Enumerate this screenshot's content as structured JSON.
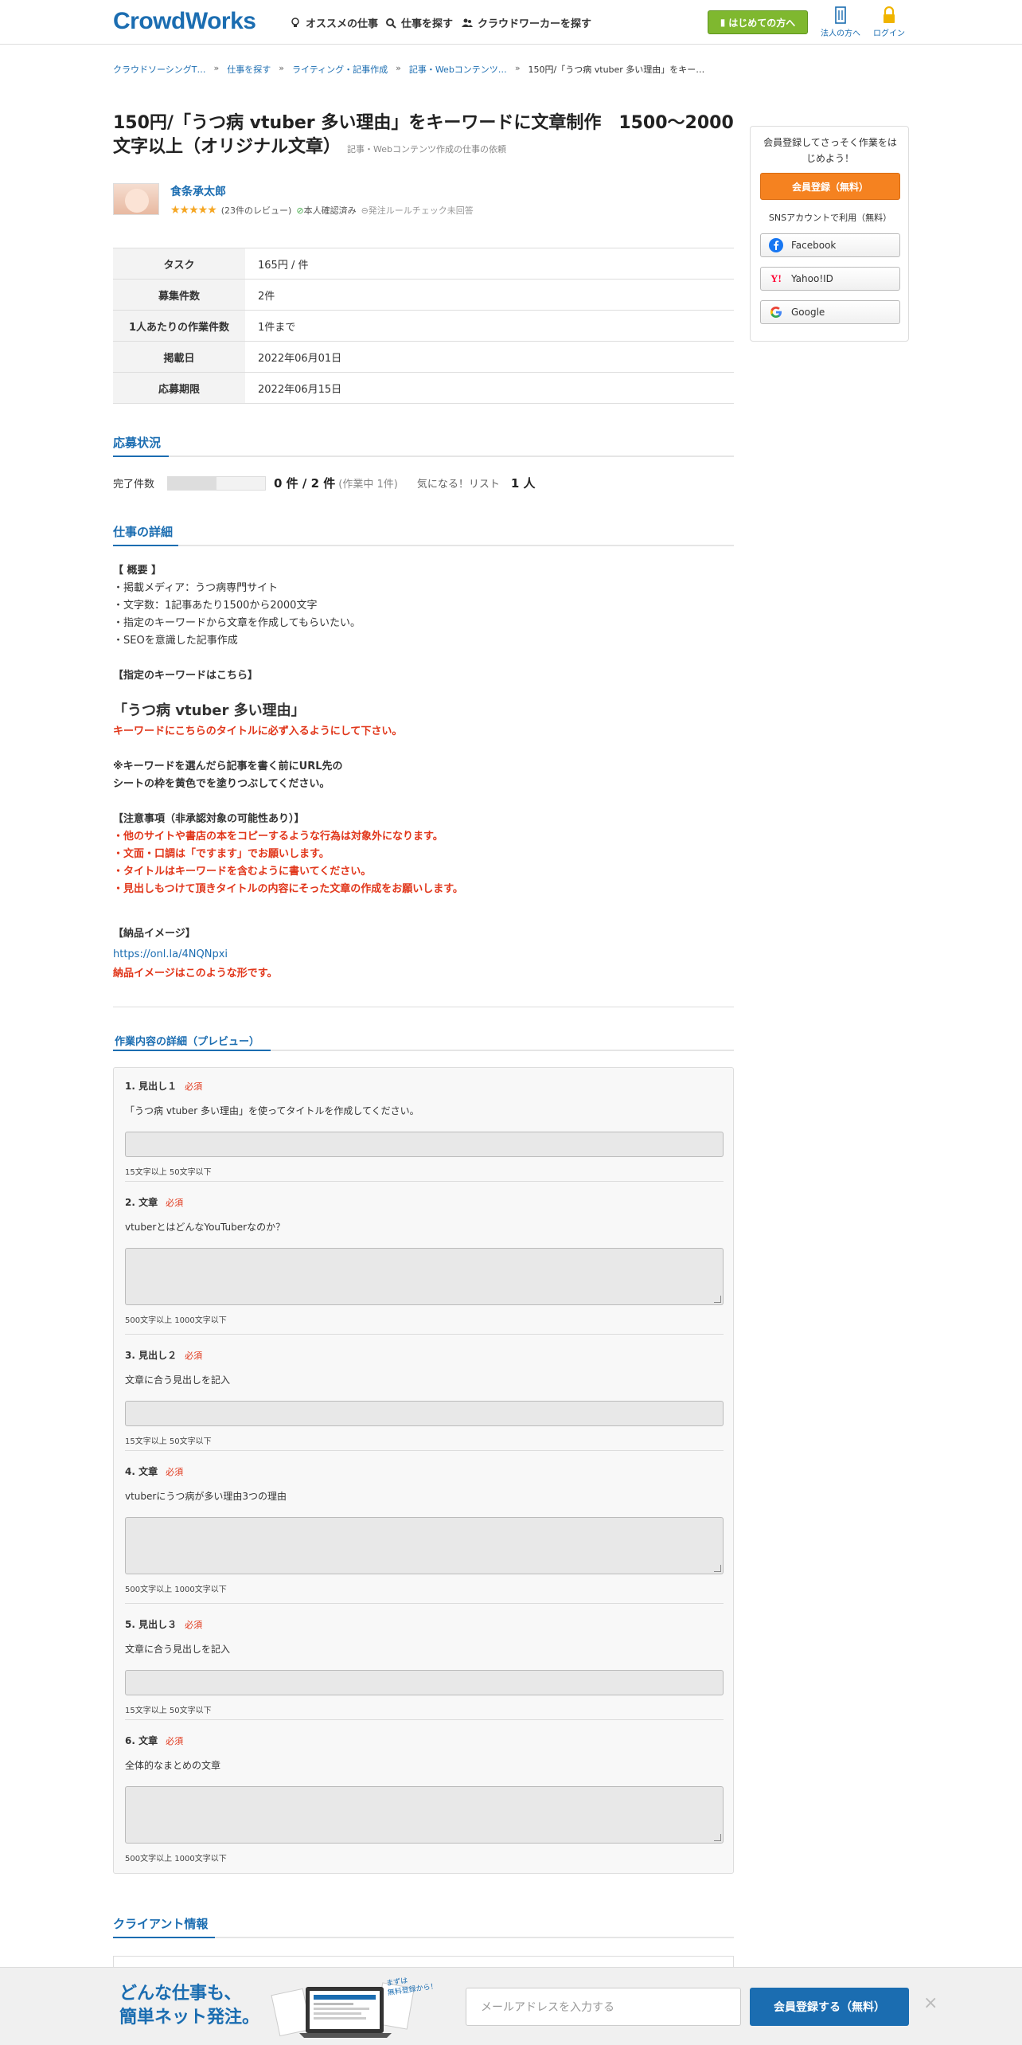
{
  "header": {
    "logo": "CrowdWorks",
    "nav": [
      {
        "label": "オススメの仕事",
        "icon": "bulb-icon"
      },
      {
        "label": "仕事を探す",
        "icon": "search-icon"
      },
      {
        "label": "クラウドワーカーを探す",
        "icon": "people-icon"
      }
    ],
    "first_button": "はじめての方へ",
    "corporate": "法人の方へ",
    "login": "ログイン"
  },
  "breadcrumbs": [
    "クラウドソーシングT…",
    "仕事を探す",
    "ライティング・記事作成",
    "記事・Webコンテンツ…",
    "150円/「うつ病 vtuber 多い理由」をキー…"
  ],
  "job": {
    "title": "150円/「うつ病 vtuber 多い理由」をキーワードに文章制作　1500〜2000文字以上（オリジナル文章）",
    "category": "記事・Webコンテンツ作成の仕事の依頼",
    "client_name": "食条承太郎",
    "stars": "★★★★★",
    "reviews": "(23件のレビュー)",
    "verified": "本人確認済み",
    "rule_check": "発注ルールチェック未回答"
  },
  "info_table": [
    {
      "label": "タスク",
      "value": "165円 / 件"
    },
    {
      "label": "募集件数",
      "value": "2件"
    },
    {
      "label": "1人あたりの作業件数",
      "value": "1件まで"
    },
    {
      "label": "掲載日",
      "value": "2022年06月01日"
    },
    {
      "label": "応募期限",
      "value": "2022年06月15日"
    }
  ],
  "status": {
    "section_title": "応募状況",
    "done_label": "完了件数",
    "progress": 0.5,
    "count": "0 件 / 2 件",
    "in_progress": "(作業中 1件)",
    "wish_label": "気になる！リスト",
    "wish_count": "1 人"
  },
  "detail": {
    "section_title": "仕事の詳細",
    "summary_head": "【 概要 】",
    "summary": [
      "・掲載メディア：うつ病専門サイト",
      "・文字数：1記事あたり1500から2000文字",
      "・指定のキーワードから文章を作成してもらいたい。",
      "・SEOを意識した記事作成"
    ],
    "keyword_head": "【指定のキーワードはこちら】",
    "keyword": "「うつ病 vtuber 多い理由」",
    "keyword_note": "キーワードにこちらのタイトルに必ず入るようにして下さい。",
    "url_note": [
      "※キーワードを選んだら記事を書く前にURL先の",
      "シートの枠を黄色でを塗りつぶしてください。"
    ],
    "caution_head": "【注意事項（非承認対象の可能性あり）】",
    "cautions": [
      "・他のサイトや書店の本をコピーするような行為は対象外になります。",
      "・文面・口調は「ですます」でお願いします。",
      "・タイトルはキーワードを含むように書いてください。",
      "・見出しもつけて頂きタイトルの内容にそった文章の作成をお願いします。"
    ],
    "delivery_head": "【納品イメージ】",
    "delivery_link": "https://onl.la/4NQNpxi",
    "delivery_note": "納品イメージはこのような形です。"
  },
  "preview": {
    "section_title": "作業内容の詳細（プレビュー）",
    "required": "必須",
    "items": [
      {
        "label": "1. 見出し１",
        "desc": "「うつ病 vtuber 多い理由」を使ってタイトルを作成してください。",
        "limit": "15文字以上 50文字以下"
      },
      {
        "label": "2. 文章",
        "desc": "vtuberとはどんなYouTuberなのか？",
        "limit": "500文字以上 1000文字以下"
      },
      {
        "label": "3. 見出し２",
        "desc": "文章に合う見出しを記入",
        "limit": "15文字以上 50文字以下"
      },
      {
        "label": "4. 文章",
        "desc": "vtuberにうつ病が多い理由3つの理由",
        "limit": "500文字以上 1000文字以下"
      },
      {
        "label": "5. 見出し３",
        "desc": "文章に合う見出しを記入",
        "limit": "15文字以上 50文字以下"
      },
      {
        "label": "6. 文章",
        "desc": "全体的なまとめの文章",
        "limit": "500文字以上 1000文字以下"
      }
    ]
  },
  "client_info": {
    "section_title": "クライアント情報"
  },
  "sidebar": {
    "message": "会員登録してさっそく作業をはじめよう！",
    "register": "会員登録（無料）",
    "sns_label": "SNSアカウントで利用（無料）",
    "facebook": "Facebook",
    "yahoo": "Yahoo!ID",
    "google": "Google"
  },
  "footer": {
    "tagline1": "どんな仕事も、",
    "tagline2": "簡単ネット発注。",
    "bubble": "まずは\n無料登録から！",
    "email_placeholder": "メールアドレスを入力する",
    "register": "会員登録する（無料）",
    "close": "×"
  },
  "colors": {
    "brand": "#1b6db1",
    "accent": "#f58220",
    "alert": "#e1361a",
    "green": "#7fb82f"
  }
}
